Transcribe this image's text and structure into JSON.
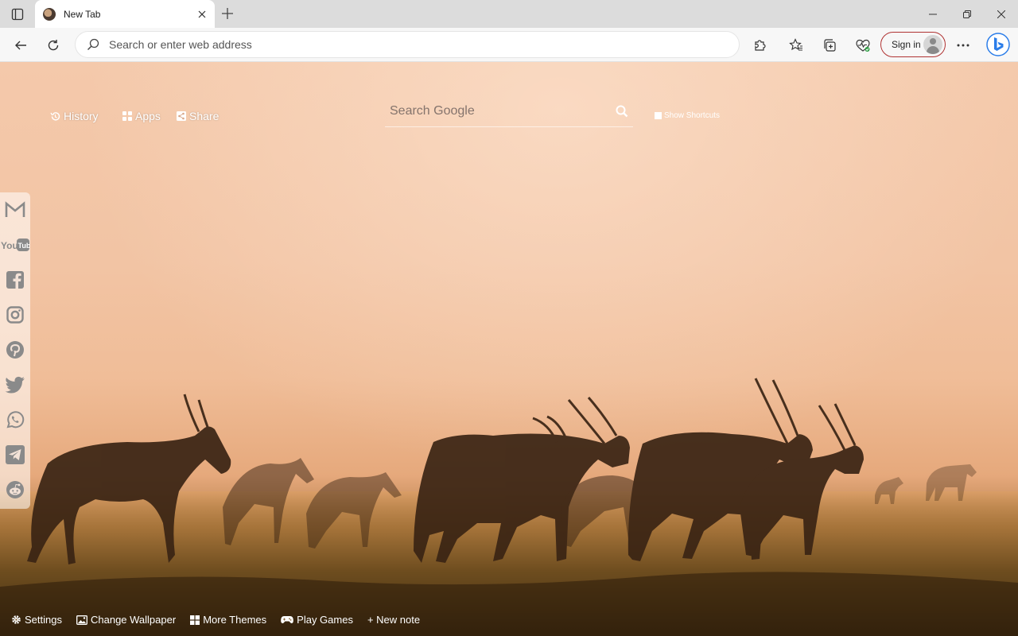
{
  "browser": {
    "tab": {
      "title": "New Tab"
    },
    "address_bar": {
      "placeholder": "Search or enter web address"
    },
    "signin": {
      "label": "Sign in"
    }
  },
  "newtab": {
    "nav": {
      "history": "History",
      "apps": "Apps",
      "share": "Share"
    },
    "search": {
      "placeholder": "Search Google"
    },
    "shortcuts": "Show Shortcuts",
    "sidebar": [
      "gmail-icon",
      "youtube-icon",
      "facebook-icon",
      "instagram-icon",
      "pinterest-icon",
      "twitter-icon",
      "whatsapp-icon",
      "telegram-icon",
      "reddit-icon"
    ],
    "bottom": {
      "settings": "Settings",
      "change_wallpaper": "Change Wallpaper",
      "more_themes": "More Themes",
      "play_games": "Play Games",
      "new_note": "+ New note"
    }
  },
  "colors": {
    "sky": "#f2c4a4",
    "signin_border": "#b03333",
    "bing_blue": "#2b7de9"
  }
}
